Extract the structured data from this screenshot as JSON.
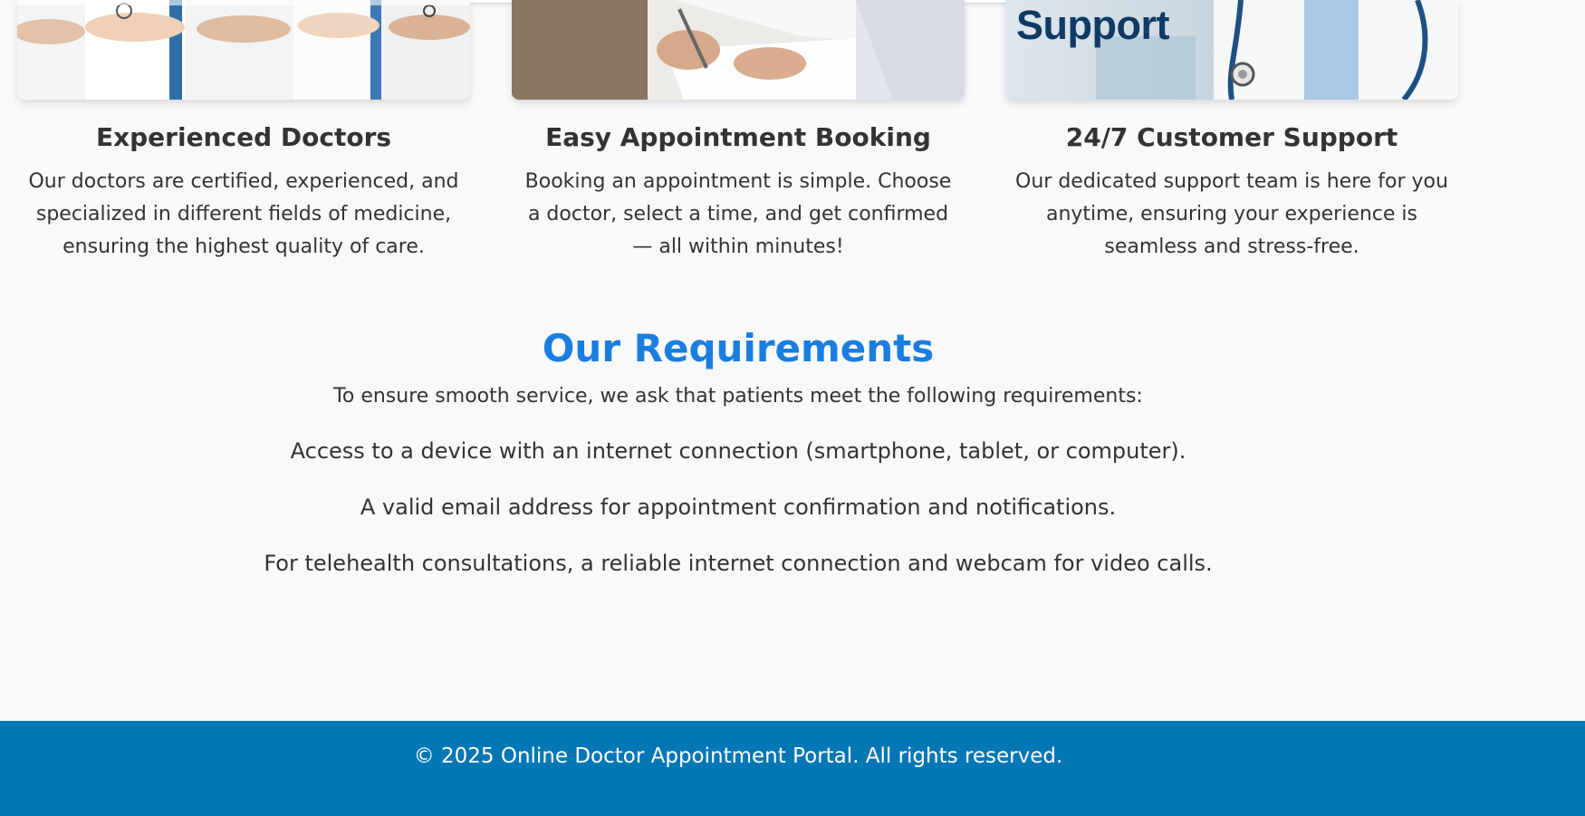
{
  "features": [
    {
      "title": "Experienced Doctors",
      "description": "Our doctors are certified, experienced, and specialized in different fields of medicine, ensuring the highest quality of care."
    },
    {
      "title": "Easy Appointment Booking",
      "description": "Booking an appointment is simple. Choose a doctor, select a time, and get confirmed — all within minutes!"
    },
    {
      "title": "24/7 Customer Support",
      "description": "Our dedicated support team is here for you anytime, ensuring your experience is seamless and stress-free.",
      "image_text": "Support"
    }
  ],
  "requirements": {
    "heading": "Our Requirements",
    "intro": "To ensure smooth service, we ask that patients meet the following requirements:",
    "items": [
      "Access to a device with an internet connection (smartphone, tablet, or computer).",
      "A valid email address for appointment confirmation and notifications.",
      "For telehealth consultations, a reliable internet connection and webcam for video calls."
    ]
  },
  "footer": {
    "copyright": "© 2025 Online Doctor Appointment Portal. All rights reserved."
  },
  "colors": {
    "heading_accent": "#1a7ee0",
    "footer_bg": "#0277b6",
    "page_bg": "#f8f9fa"
  },
  "icons": [
    "doctors-team-photo",
    "appointment-booking-photo",
    "customer-support-photo",
    "stethoscope-icon"
  ]
}
